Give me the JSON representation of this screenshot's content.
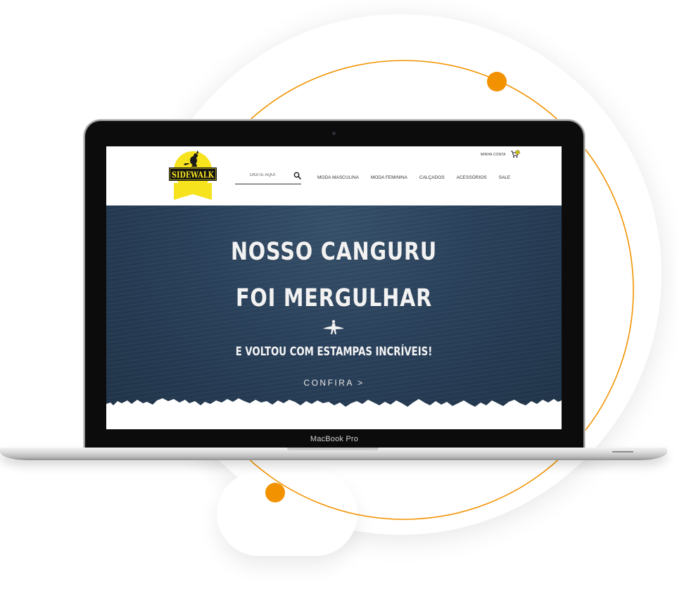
{
  "device": {
    "label": "MacBook Pro"
  },
  "header": {
    "logo_text": "SIDEWALK",
    "account_label": "MINHA CONTA",
    "cart_count": "0",
    "search": {
      "placeholder": "DIGITE AQUI"
    },
    "nav": [
      {
        "label": "MODA MASCULINA"
      },
      {
        "label": "MODA FEMININA"
      },
      {
        "label": "CALÇADOS"
      },
      {
        "label": "ACESSÓRIOS"
      },
      {
        "label": "SALE"
      }
    ]
  },
  "hero": {
    "line1": "NOSSO CANGURU",
    "line2": "FOI MERGULHAR",
    "subtitle": "E VOLTOU COM ESTAMPAS INCRÍVEIS!",
    "cta": "CONFIRA >"
  },
  "colors": {
    "accent": "#f39200",
    "logo_yellow": "#f6e21d",
    "hero_blue": "#29405a"
  },
  "icons": [
    "search-icon",
    "cart-icon",
    "kangaroo-icon",
    "surfer-icon",
    "webcam"
  ]
}
